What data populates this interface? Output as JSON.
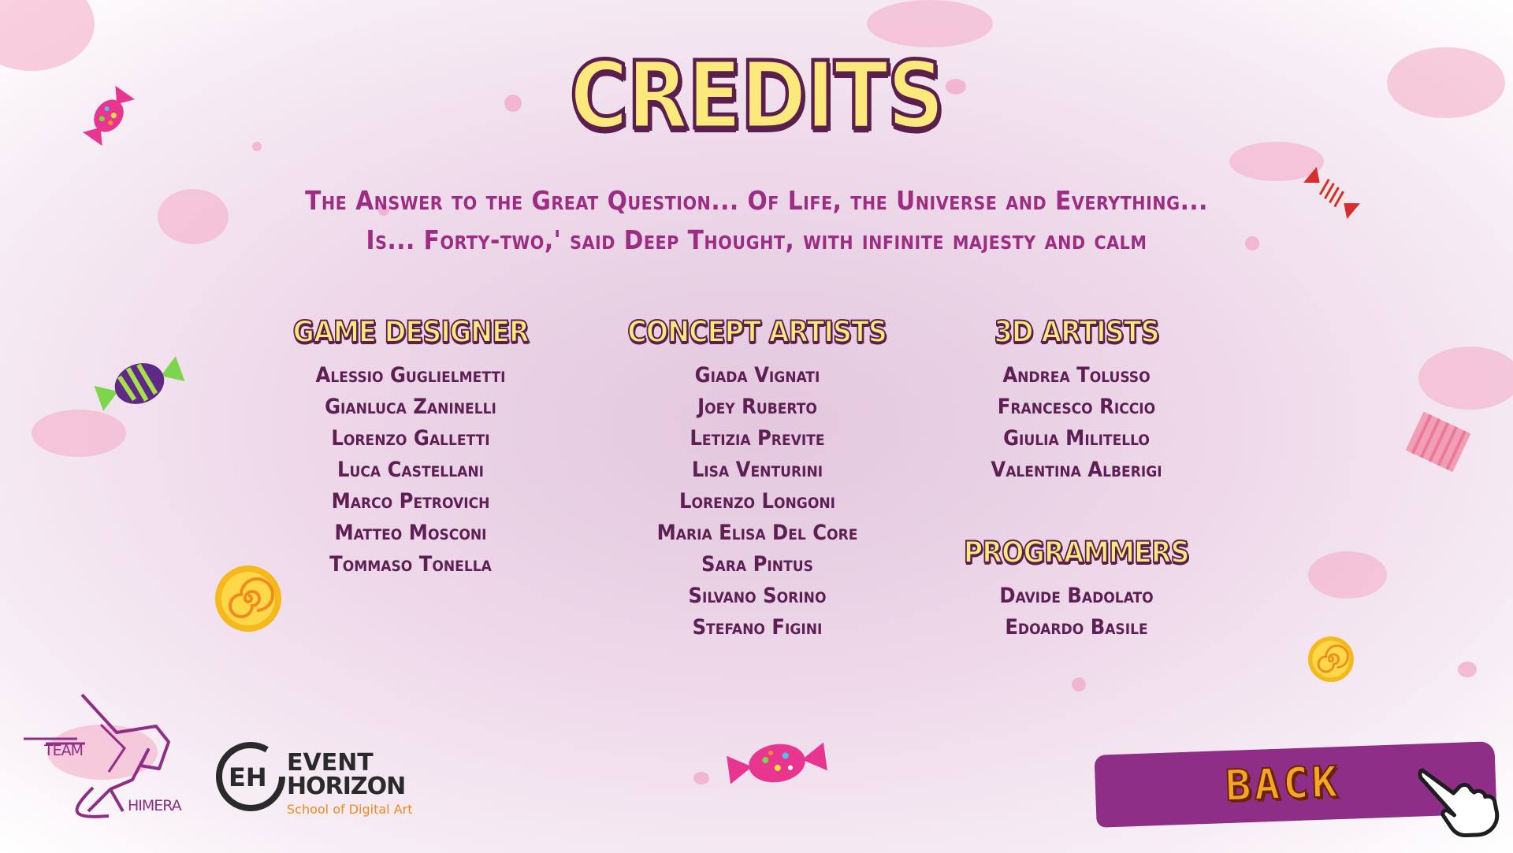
{
  "title": "CREDITS",
  "quote": {
    "line1": "The Answer to the Great Question... Of Life, the Universe and Everything...",
    "line2": "Is... Forty-two,' said Deep Thought, with infinite majesty and calm"
  },
  "sections": {
    "game_designer": {
      "heading": "GAME DESIGNER",
      "names": [
        "Alessio Guglielmetti",
        "Gianluca Zaninelli",
        "Lorenzo Galletti",
        "Luca Castellani",
        "Marco Petrovich",
        "Matteo Mosconi",
        "Tommaso Tonella"
      ]
    },
    "concept_artists": {
      "heading": "CONCEPT ARTISTS",
      "names": [
        "Giada Vignati",
        "Joey Ruberto",
        "Letizia Previte",
        "Lisa Venturini",
        "Lorenzo Longoni",
        "Maria Elisa Del Core",
        "Sara Pintus",
        "Silvano Sorino",
        "Stefano Figini"
      ]
    },
    "artists_3d": {
      "heading": "3D ARTISTS",
      "names": [
        "Andrea Tolusso",
        "Francesco Riccio",
        "Giulia Militello",
        "Valentina Alberigi"
      ]
    },
    "programmers": {
      "heading": "PROGRAMMERS",
      "names": [
        "Davide Badolato",
        "Edoardo Basile"
      ]
    }
  },
  "logos": {
    "team": {
      "line1": "TEAM",
      "line2": "HIMERA"
    },
    "school": {
      "line1": "EVENT",
      "line2": "HORIZON",
      "line3": "School of Digital Art"
    }
  },
  "back_button": {
    "label": "BACK"
  },
  "colors": {
    "title_fill": "#fbe97c",
    "title_outline": "#5b1f4d",
    "quote_text": "#9c2d83",
    "name_text": "#5e1f54",
    "button_bg": "#8e2e86",
    "button_text": "#f5a623"
  },
  "icons": [
    "candy-pink-icon",
    "candy-green-icon",
    "candy-red-icon",
    "lollipop-yellow-icon",
    "pink-box-icon",
    "pointing-hand-icon"
  ]
}
